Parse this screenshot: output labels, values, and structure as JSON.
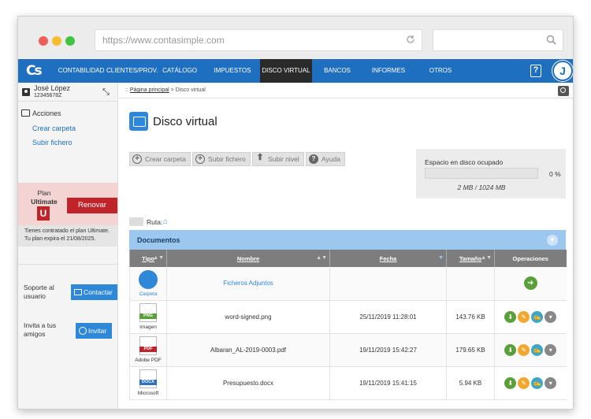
{
  "browser": {
    "url": "https://www.contasimple.com",
    "search_placeholder": ""
  },
  "nav": {
    "logo": "Cs",
    "items": [
      "CONTABILIDAD",
      "CLIENTES/PROV.",
      "CATÁLOGO",
      "IMPUESTOS",
      "DISCO VIRTUAL",
      "BANCOS",
      "INFORMES",
      "OTROS"
    ],
    "active": "DISCO VIRTUAL",
    "help": "?",
    "avatar": "J"
  },
  "sidebar": {
    "user_name": "José López",
    "user_id": "12345678Z",
    "actions_title": "Acciones",
    "actions": [
      "Crear carpeta",
      "Subir fichero"
    ],
    "plan": {
      "label": "Plan",
      "name": "Ultimate",
      "badge": "U",
      "renew": "Renovar",
      "info_1": "Tienes contratado el plan Ultimate.",
      "info_2": "Tu plan expira el 21/08/2025."
    },
    "support_1": "Soporte al",
    "support_2": "usuario",
    "contact": "Contactar",
    "invite_1": "Invita a tus",
    "invite_2": "amigos",
    "invite": "Invitar"
  },
  "breadcrumb": {
    "prefix": "::",
    "home": "Página principal",
    "sep": ">",
    "current": "Disco virtual"
  },
  "page": {
    "title": "Disco virtual"
  },
  "toolbar": {
    "create": "Crear carpeta",
    "upload": "Subir fichero",
    "up": "Subir nivel",
    "help": "Ayuda"
  },
  "disk": {
    "label": "Espacio en disco ocupado",
    "percent": "0 %",
    "used": "2 MB / 1024 MB",
    "fill": 0
  },
  "ruta": {
    "label": "Ruta:"
  },
  "documents": {
    "title": "Documentos",
    "columns": [
      "Tipo",
      "Nombre",
      "Fecha",
      "Tamaño",
      "Operaciones"
    ],
    "rows": [
      {
        "type": "Carpeta",
        "name": "Ficheros Adjuntos",
        "date": "",
        "size": ""
      },
      {
        "type": "Imagen",
        "tag": "PNG",
        "name": "word-signed.png",
        "date": "25/11/2019 11:28:01",
        "size": "143.76 KB"
      },
      {
        "type": "Adobe PDF",
        "tag": "PDF",
        "name": "Albaran_AL-2019-0003.pdf",
        "date": "19/11/2019 15:42:27",
        "size": "179.65 KB"
      },
      {
        "type": "Microsoft",
        "tag": "DOCX",
        "name": "Presupuesto.docx",
        "date": "19/11/2019 15:41:15",
        "size": "5.94 KB"
      }
    ]
  },
  "colors": {
    "nav": "#1f6fc0",
    "active": "#2a2a2a",
    "renew": "#c0242b",
    "download": "#5aa03a",
    "edit": "#f0a830",
    "sign": "#3aa7c8",
    "more": "#888888"
  }
}
